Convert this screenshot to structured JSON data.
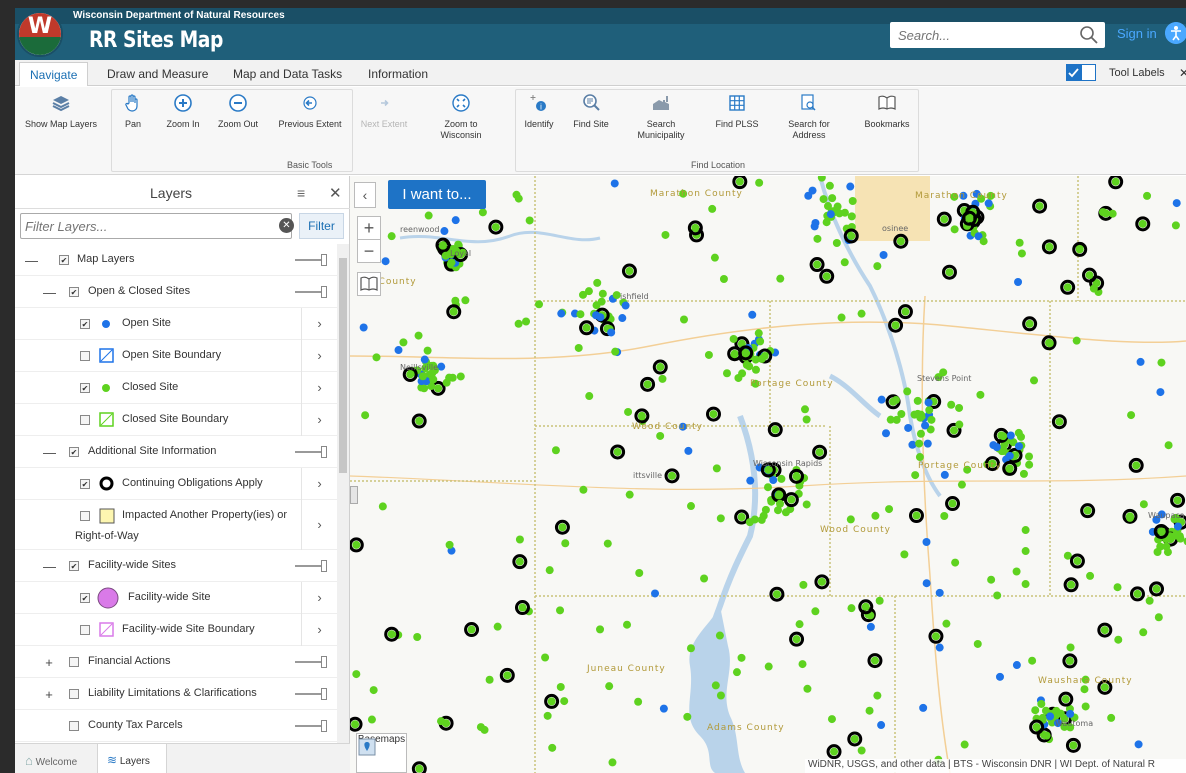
{
  "header": {
    "agency": "Wisconsin Department of Natural Resources",
    "title": "RR Sites Map",
    "search_placeholder": "Search...",
    "sign_in": "Sign in"
  },
  "ribbon": {
    "tabs": [
      "Navigate",
      "Draw and Measure",
      "Map and Data Tasks",
      "Information"
    ],
    "active_tab": "Navigate",
    "tool_labels": "Tool Labels",
    "tool_labels_checked": true
  },
  "toolbar": {
    "show_map_layers": "Show Map Layers",
    "basic_tools": {
      "group_label": "Basic Tools",
      "pan": "Pan",
      "zoom_in": "Zoom In",
      "zoom_out": "Zoom Out",
      "previous_extent": "Previous Extent",
      "next_extent": "Next Extent",
      "zoom_to_wisconsin": "Zoom to Wisconsin"
    },
    "find_location": {
      "group_label": "Find Location",
      "identify": "Identify",
      "find_site": "Find Site",
      "search_municipality": "Search Municipality",
      "find_plss": "Find PLSS",
      "search_address": "Search for Address",
      "bookmarks": "Bookmarks"
    }
  },
  "layers_panel": {
    "title": "Layers",
    "filter_placeholder": "Filter Layers...",
    "filter_button": "Filter",
    "rows": [
      {
        "label": "Map Layers",
        "checked": true
      },
      {
        "label": "Open & Closed Sites",
        "checked": true
      },
      {
        "label": "Open Site",
        "checked": true
      },
      {
        "label": "Open Site Boundary",
        "checked": false
      },
      {
        "label": "Closed Site",
        "checked": true
      },
      {
        "label": "Closed Site Boundary",
        "checked": false
      },
      {
        "label": "Additional Site Information",
        "checked": true
      },
      {
        "label": "Continuing Obligations Apply",
        "checked": true
      },
      {
        "label": "Impacted Another Property(ies) or",
        "label2": "Right-of-Way",
        "checked": false
      },
      {
        "label": "Facility-wide Sites",
        "checked": true
      },
      {
        "label": "Facility-wide Site",
        "checked": true
      },
      {
        "label": "Facility-wide Site Boundary",
        "checked": false
      },
      {
        "label": "Financial Actions",
        "checked": false
      },
      {
        "label": "Liability Limitations & Clarifications",
        "checked": false
      },
      {
        "label": "County Tax Parcels",
        "checked": false
      }
    ],
    "bottom_tabs": [
      "Welcome",
      "Layers"
    ]
  },
  "map": {
    "i_want_to": "I want to...",
    "basemaps": "Basemaps",
    "attribution": "WiDNR, USGS, and other data | BTS - Wisconsin DNR | WI Dept. of Natural R",
    "labels": {
      "marathon_county": "Marathon County",
      "marathon_county_2": "Marathon County",
      "clark_county": "r County",
      "greenwood": "reenwood",
      "loyal": "Loyal",
      "marshfield": "ishfield",
      "neillsville": "Neillsville",
      "portage_county": "Portage County",
      "wood_county": "Wood County",
      "wood_county_2": "Wood County",
      "wisconsin_rapids": "Wisconsin Rapids",
      "pittsville": "ittsville",
      "stevens_point": "Stevens Point",
      "portage_county_2": "Portage County",
      "juneau_county": "Juneau County",
      "adams_county": "Adams County",
      "waushara": "Waushara County",
      "waupaca": "Waupaca",
      "wautoma": "Wautoma",
      "mosinee": "osinee"
    },
    "colors": {
      "open_site": "#1e73e8",
      "closed_site": "#5ed21f",
      "continuing_obligation": "#000000",
      "facility_wide": "#d97ae8",
      "county_line": "#c9c27a",
      "water": "#b9d3ea",
      "urban": "#f6e3b4"
    }
  }
}
